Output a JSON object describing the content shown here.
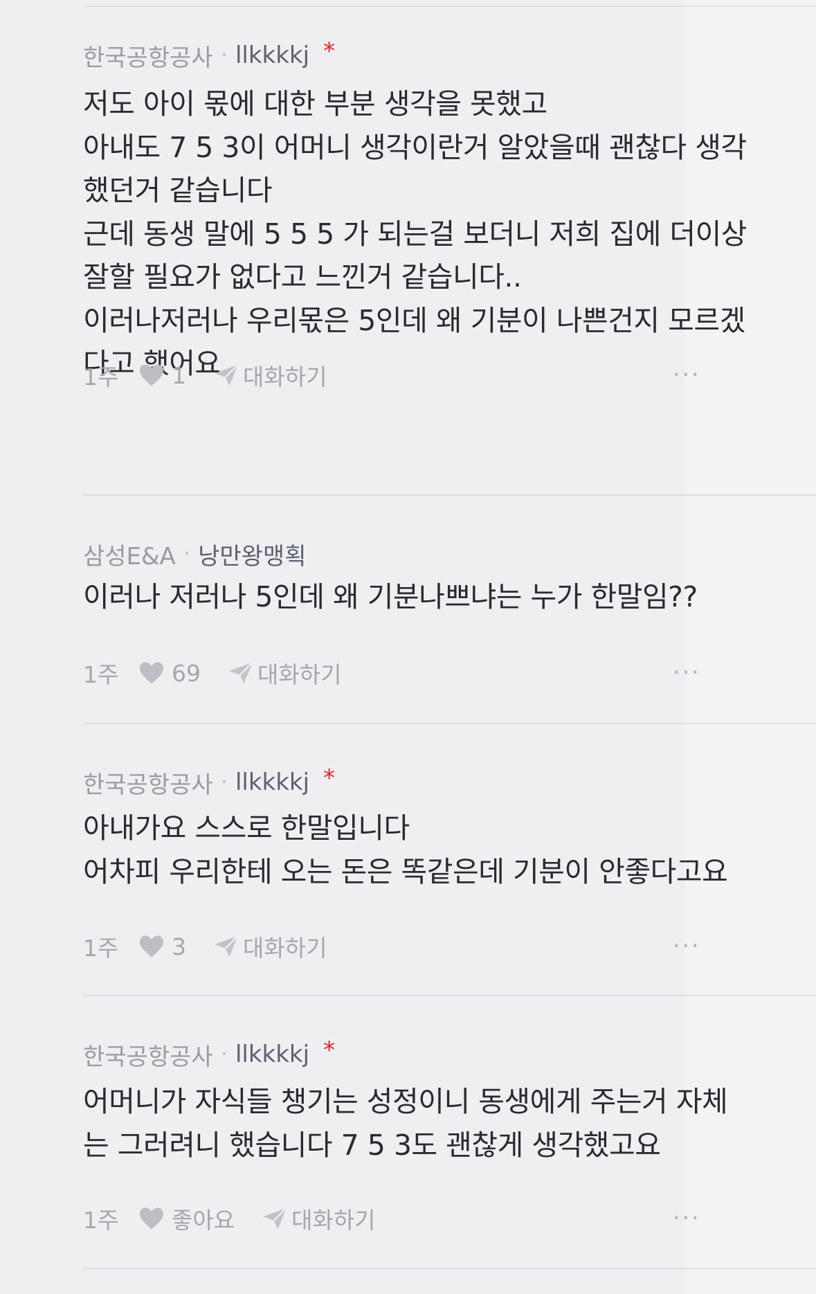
{
  "colors": {
    "background": "#efeff2",
    "company": "#9a9aa2",
    "nickname": "#5b6270",
    "author_star": "#e02525",
    "meta": "#a6a6ae"
  },
  "icons": {
    "like": "heart-icon",
    "reply": "paper-plane-icon",
    "more": "more-dots-icon"
  },
  "comments": [
    {
      "company": "한국공항공사",
      "separator": "·",
      "nickname": "llkkkkj",
      "author_star": "*",
      "body": "저도 아이 몫에 대한 부분 생각을 못했고\n아내도 7 5 3이 어머니 생각이란거 알았을때 괜찮다 생각\n했던거 같습니다\n근데 동생 말에 5 5 5 가 되는걸 보더니 저희 집에 더이상\n잘할 필요가 없다고 느낀거 같습니다..\n이러나저러나 우리몫은 5인데 왜 기분이 나쁜건지 모르겠\n다고 했어요",
      "time": "1주",
      "likes": "1",
      "reply_label": "대화하기",
      "more": "···"
    },
    {
      "company": "삼성E&A",
      "separator": "·",
      "nickname": "낭만왕맹획",
      "body": "이러나 저러나 5인데 왜 기분나쁘냐는 누가 한말임??",
      "time": "1주",
      "likes": "69",
      "reply_label": "대화하기",
      "more": "···"
    },
    {
      "company": "한국공항공사",
      "separator": "·",
      "nickname": "llkkkkj",
      "author_star": "*",
      "body": "아내가요 스스로 한말입니다\n어차피 우리한테 오는 돈은 똑같은데 기분이 안좋다고요",
      "time": "1주",
      "likes": "3",
      "reply_label": "대화하기",
      "more": "···"
    },
    {
      "company": "한국공항공사",
      "separator": "·",
      "nickname": "llkkkkj",
      "author_star": "*",
      "body": "어머니가 자식들 챙기는 성정이니 동생에게 주는거 자체\n는 그러려니 했습니다 7 5 3도 괜찮게 생각했고요",
      "time": "1주",
      "likes": "좋아요",
      "reply_label": "대화하기",
      "more": "···"
    }
  ]
}
